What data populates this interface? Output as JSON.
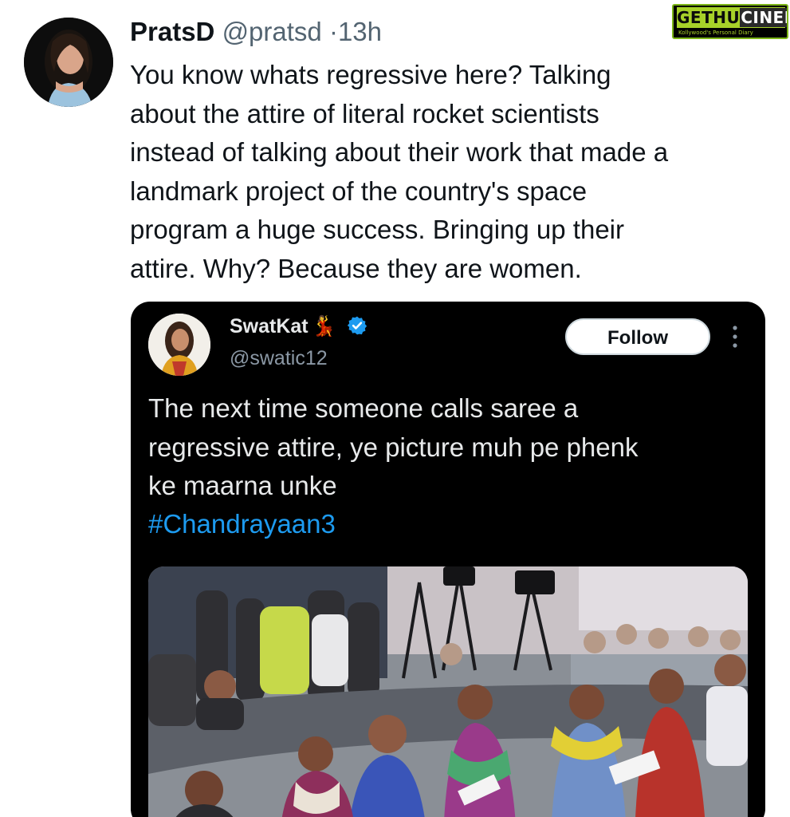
{
  "tweet": {
    "author_name": "PratsD",
    "author_handle": "@pratsd",
    "separator": "·",
    "time": "13h",
    "text": "You know whats regressive here? Talking\nabout the attire of literal rocket scientists\ninstead of talking about their work that made a\nlandmark project of the country's space\nprogram a huge success. Bringing up their\nattire. Why? Because they are women."
  },
  "quoted_tweet": {
    "author_name": "SwatKat",
    "author_emoji": "💃",
    "author_handle": "@swatic12",
    "follow_label": "Follow",
    "text": "The next time someone calls saree a\nregressive attire, ye picture muh pe phenk\nke maarna unke",
    "hashtag": "#Chandrayaan3",
    "verified_color": "#1d9bf0",
    "hashtag_color": "#1d9bf0"
  },
  "watermark": {
    "title_part1": "GETHU",
    "title_part2": "CINEMA",
    "subtitle": "Kollywood's Personal Diary"
  },
  "icons": [
    "avatar-photo",
    "verified-badge-icon",
    "more-options-icon"
  ]
}
